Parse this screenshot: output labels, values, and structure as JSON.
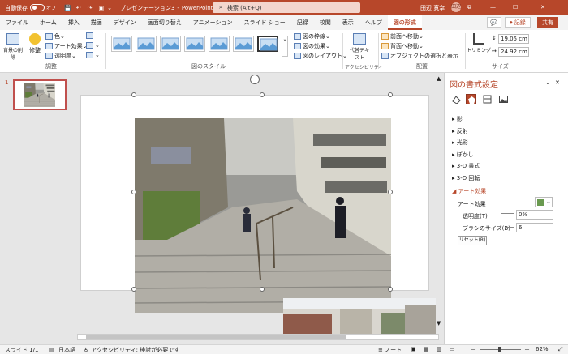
{
  "titlebar": {
    "autosave": "自動保存",
    "autosave_state": "オフ",
    "doc_title": "プレゼンテーション3",
    "separator": "-",
    "app": "PowerPoint",
    "search": "検索 (Alt+Q)",
    "user": "田辺 寛幸",
    "user_initials": "田辺",
    "min": "—",
    "max": "☐",
    "close": "✕"
  },
  "tabs": [
    "ファイル",
    "ホーム",
    "挿入",
    "描画",
    "デザイン",
    "画面切り替え",
    "アニメーション",
    "スライド ショー",
    "記録",
    "校閲",
    "表示",
    "ヘルプ",
    "図の形式"
  ],
  "header_buttons": {
    "comment": "💬",
    "record": "⏺ 記録",
    "share": "共有"
  },
  "ribbon": {
    "remove_bg": "背景の削除",
    "corrections": "修整",
    "color": "色",
    "artistic": "アート効果",
    "transparency": "透明度",
    "adjust_group": "調整",
    "styles_group": "図のスタイル",
    "border": "図の枠線",
    "effects": "図の効果",
    "layout": "図のレイアウト",
    "alt_text": "代替テキスト",
    "accessibility_group": "アクセシビリティ",
    "bring_forward": "前面へ移動",
    "send_backward": "背面へ移動",
    "selection_pane": "オブジェクトの選択と表示",
    "arrange_group": "配置",
    "crop": "トリミング",
    "height": "19.05 cm",
    "width": "24.92 cm",
    "size_group": "サイズ"
  },
  "slide_panel": {
    "number": "1"
  },
  "pane": {
    "title": "図の書式設定",
    "close": "✕",
    "options": "⌄",
    "sections": [
      "影",
      "反射",
      "光彩",
      "ぼかし",
      "3-D 書式",
      "3-D 回転"
    ],
    "active_section": "アート効果",
    "art_effect_label": "アート効果",
    "transparency_label": "透明度(T)",
    "transparency_value": "0%",
    "brush_label": "ブラシのサイズ(B)",
    "brush_value": "6",
    "reset": "リセット(R)"
  },
  "status": {
    "slide": "スライド 1/1",
    "language": "日本語",
    "accessibility": "アクセシビリティ: 検討が必要です",
    "notes": "ノート",
    "zoom": "62%",
    "minus": "－",
    "plus": "＋"
  },
  "colors": {
    "accent": "#b7472a",
    "selected_tab": "#b7472a"
  }
}
